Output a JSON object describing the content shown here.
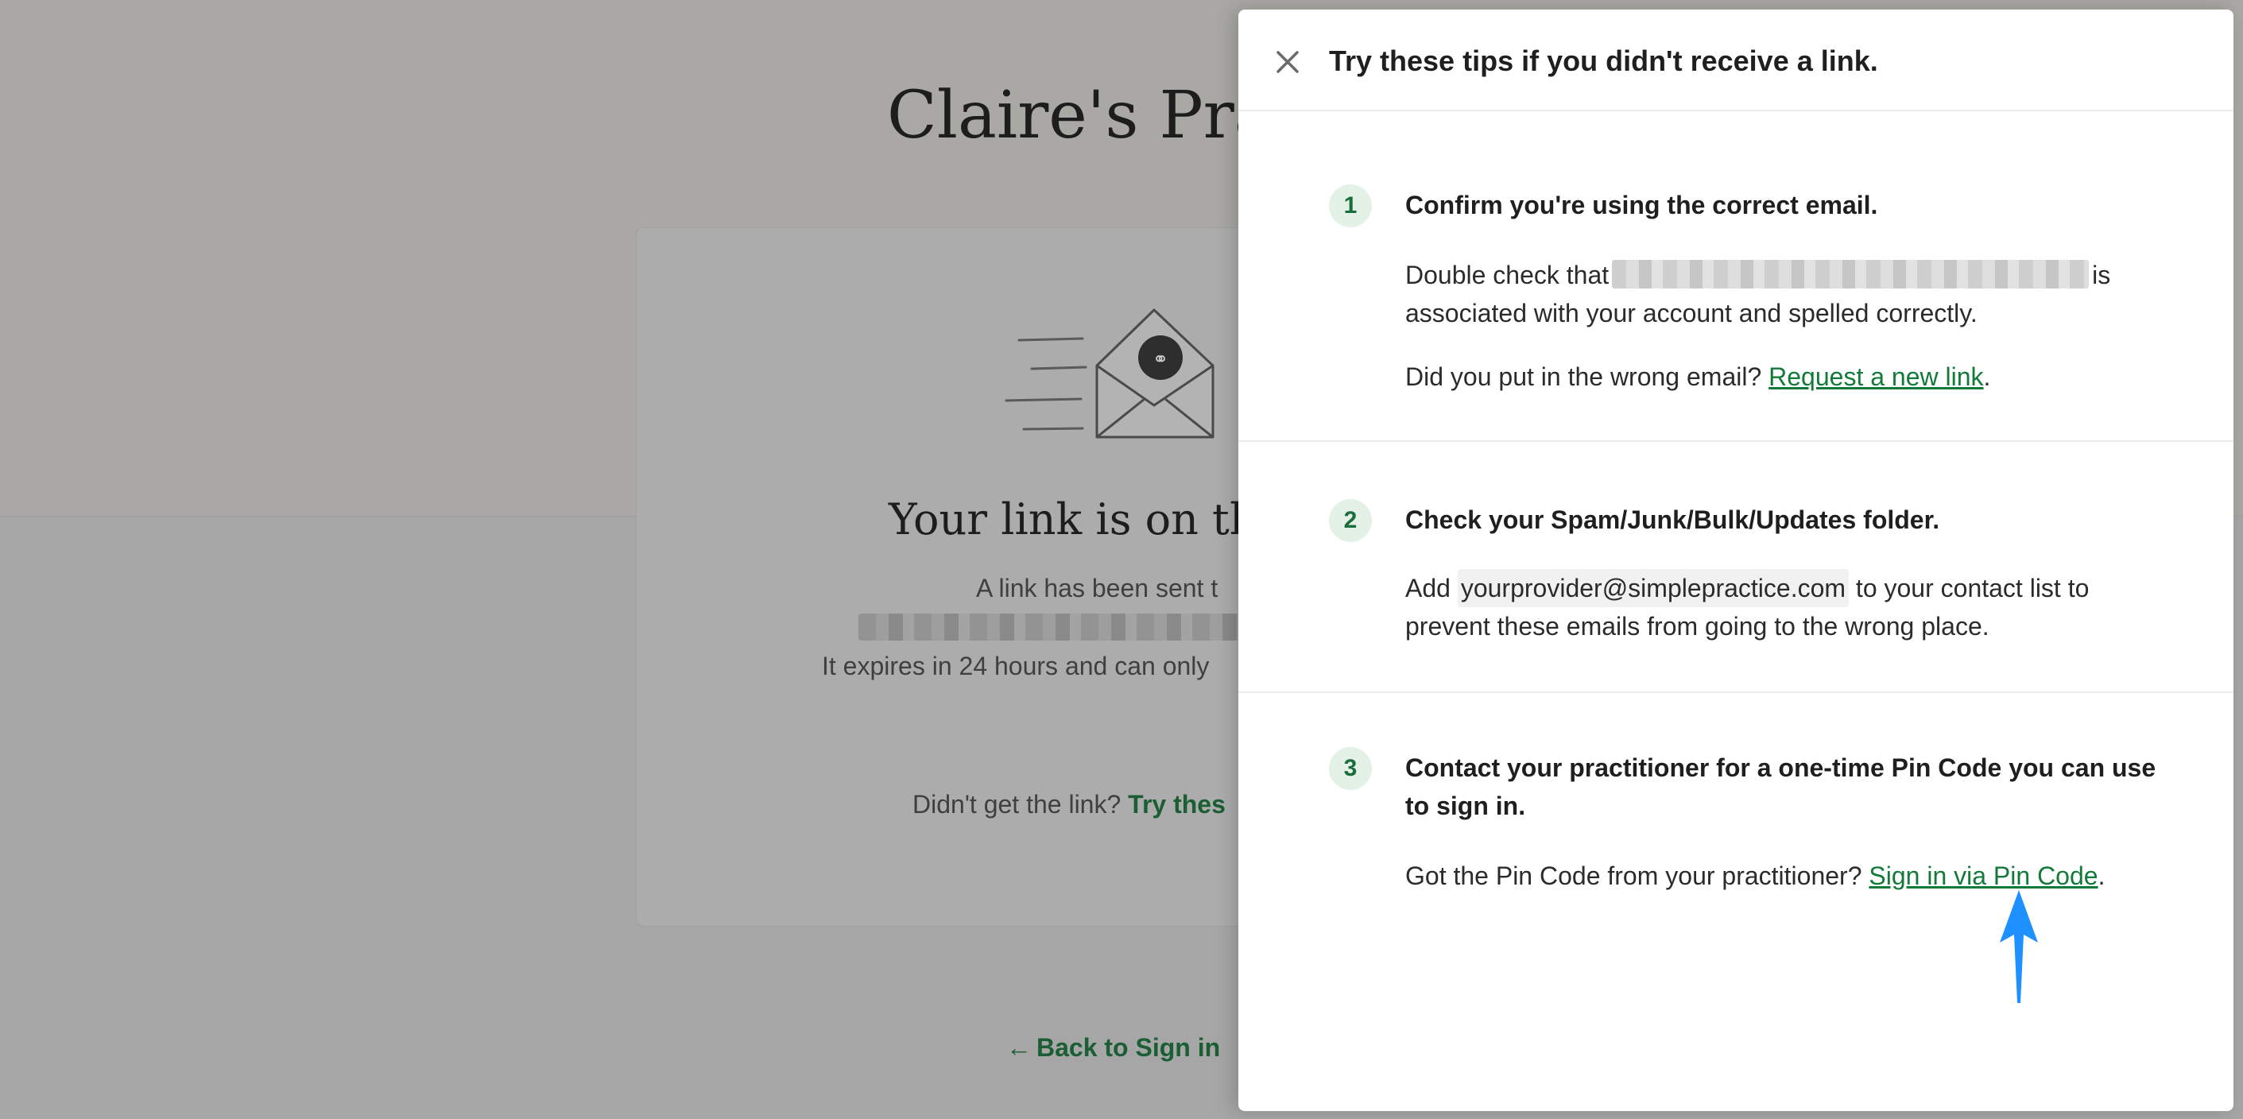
{
  "background": {
    "practice_title": "Claire's Prac",
    "card_heading": "Your link is on the",
    "card_line1": "A link has been sent t",
    "card_line2": "It expires in 24 hours and can only",
    "card_help_prefix": "Didn't get the link?",
    "card_help_link": "Try thes",
    "back_link": "Back to Sign in"
  },
  "drawer": {
    "title": "Try these tips if you didn't receive a link.",
    "tips": [
      {
        "number": "1",
        "title": "Confirm you're using the correct email.",
        "body_prefix": "Double check that",
        "body_suffix": "is associated with your account and spelled correctly.",
        "body2_prefix": "Did you put in the wrong email?",
        "body2_link": "Request a new link",
        "body2_suffix": "."
      },
      {
        "number": "2",
        "title": "Check your Spam/Junk/Bulk/Updates folder.",
        "body_prefix": "Add",
        "body_code": "yourprovider@simplepractice.com",
        "body_suffix": "to your contact list to prevent these emails from going to the wrong place."
      },
      {
        "number": "3",
        "title": "Contact your practitioner for a one-time Pin Code you can use to sign in.",
        "body_prefix": "Got the Pin Code from your practitioner?",
        "body_link": "Sign in via Pin Code",
        "body_suffix": "."
      }
    ]
  },
  "colors": {
    "accent_green": "#137a3a",
    "annotation_blue": "#1e90ff"
  }
}
